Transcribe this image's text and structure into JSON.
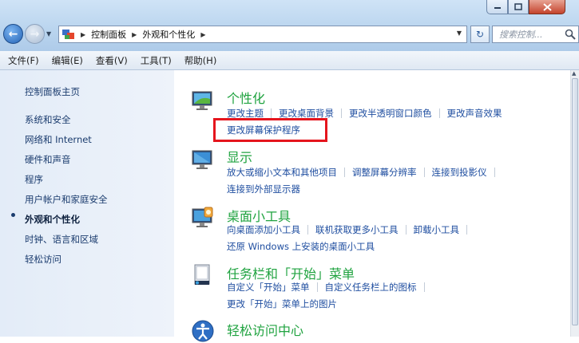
{
  "window": {
    "caption_buttons": {
      "min_icon": "minimize-icon",
      "max_icon": "maximize-icon",
      "close_icon": "close-icon"
    }
  },
  "address_bar": {
    "breadcrumbs": [
      "控制面板",
      "外观和个性化"
    ],
    "search_placeholder": "搜索控制..."
  },
  "menu": [
    "文件(F)",
    "编辑(E)",
    "查看(V)",
    "工具(T)",
    "帮助(H)"
  ],
  "sidebar": {
    "items": [
      {
        "label": "控制面板主页"
      },
      {
        "label": "系统和安全"
      },
      {
        "label": "网络和 Internet"
      },
      {
        "label": "硬件和声音"
      },
      {
        "label": "程序"
      },
      {
        "label": "用户帐户和家庭安全"
      },
      {
        "label": "外观和个性化",
        "current": true
      },
      {
        "label": "时钟、语言和区域"
      },
      {
        "label": "轻松访问"
      }
    ]
  },
  "categories": [
    {
      "title": "个性化",
      "icon": "personalization-icon",
      "rows": [
        [
          "更改主题",
          "更改桌面背景",
          "更改半透明窗口颜色",
          "更改声音效果"
        ],
        [
          "更改屏幕保护程序"
        ]
      ]
    },
    {
      "title": "显示",
      "icon": "display-icon",
      "rows": [
        [
          "放大或缩小文本和其他项目",
          "调整屏幕分辨率",
          "连接到投影仪"
        ],
        [
          "连接到外部显示器"
        ]
      ]
    },
    {
      "title": "桌面小工具",
      "icon": "gadgets-icon",
      "rows": [
        [
          "向桌面添加小工具",
          "联机获取更多小工具",
          "卸载小工具"
        ],
        [
          "还原 Windows 上安装的桌面小工具"
        ]
      ]
    },
    {
      "title": "任务栏和「开始」菜单",
      "icon": "taskbar-icon",
      "rows": [
        [
          "自定义「开始」菜单",
          "自定义任务栏上的图标"
        ],
        [
          "更改「开始」菜单上的图片"
        ]
      ]
    },
    {
      "title": "轻松访问中心",
      "icon": "ease-of-access-icon",
      "rows": []
    }
  ],
  "highlight_color": "#e5151d",
  "accent_green": "#20a340",
  "link_blue": "#1f4ea0"
}
